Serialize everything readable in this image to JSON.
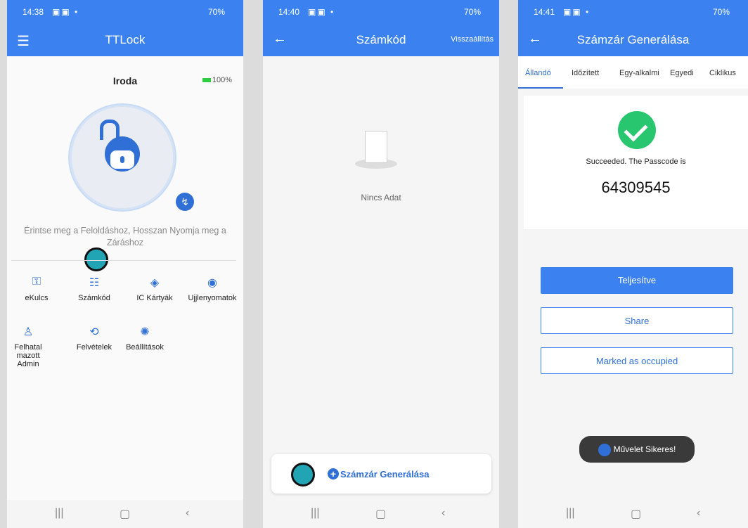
{
  "screen1": {
    "status": {
      "time": "14:38",
      "battery": "70%"
    },
    "title": "TTLock",
    "lock_name": "Iroda",
    "battery_level": "100%",
    "hint": "Érintse meg a Feloldáshoz, Hosszan Nyomja meg a Záráshoz",
    "menu": [
      {
        "label": "eKulcs"
      },
      {
        "label": "Számkód"
      },
      {
        "label": "IC Kártyák"
      },
      {
        "label": "Ujjlenyomatok"
      },
      {
        "label": "Felhatal mazott Admin"
      },
      {
        "label": "Felvételek"
      },
      {
        "label": "Beállítások"
      }
    ]
  },
  "screen2": {
    "status": {
      "time": "14:40",
      "battery": "70%"
    },
    "title": "Számkód",
    "reset": "Visszaállítás",
    "empty": "Nincs Adat",
    "generate": "Számzár Generálása"
  },
  "screen3": {
    "status": {
      "time": "14:41",
      "battery": "70%"
    },
    "title": "Számzár Generálása",
    "tabs": [
      "Állandó",
      "Időzített",
      "Egy-alkalmi",
      "Egyedi",
      "Ciklikus"
    ],
    "success": "Succeeded. The Passcode is",
    "passcode": "64309545",
    "done": "Teljesítve",
    "share": "Share",
    "occupied": "Marked as occupied",
    "toast": "Művelet Sikeres!"
  },
  "colors": {
    "accent": "#3b82f0",
    "success": "#28c76f"
  }
}
